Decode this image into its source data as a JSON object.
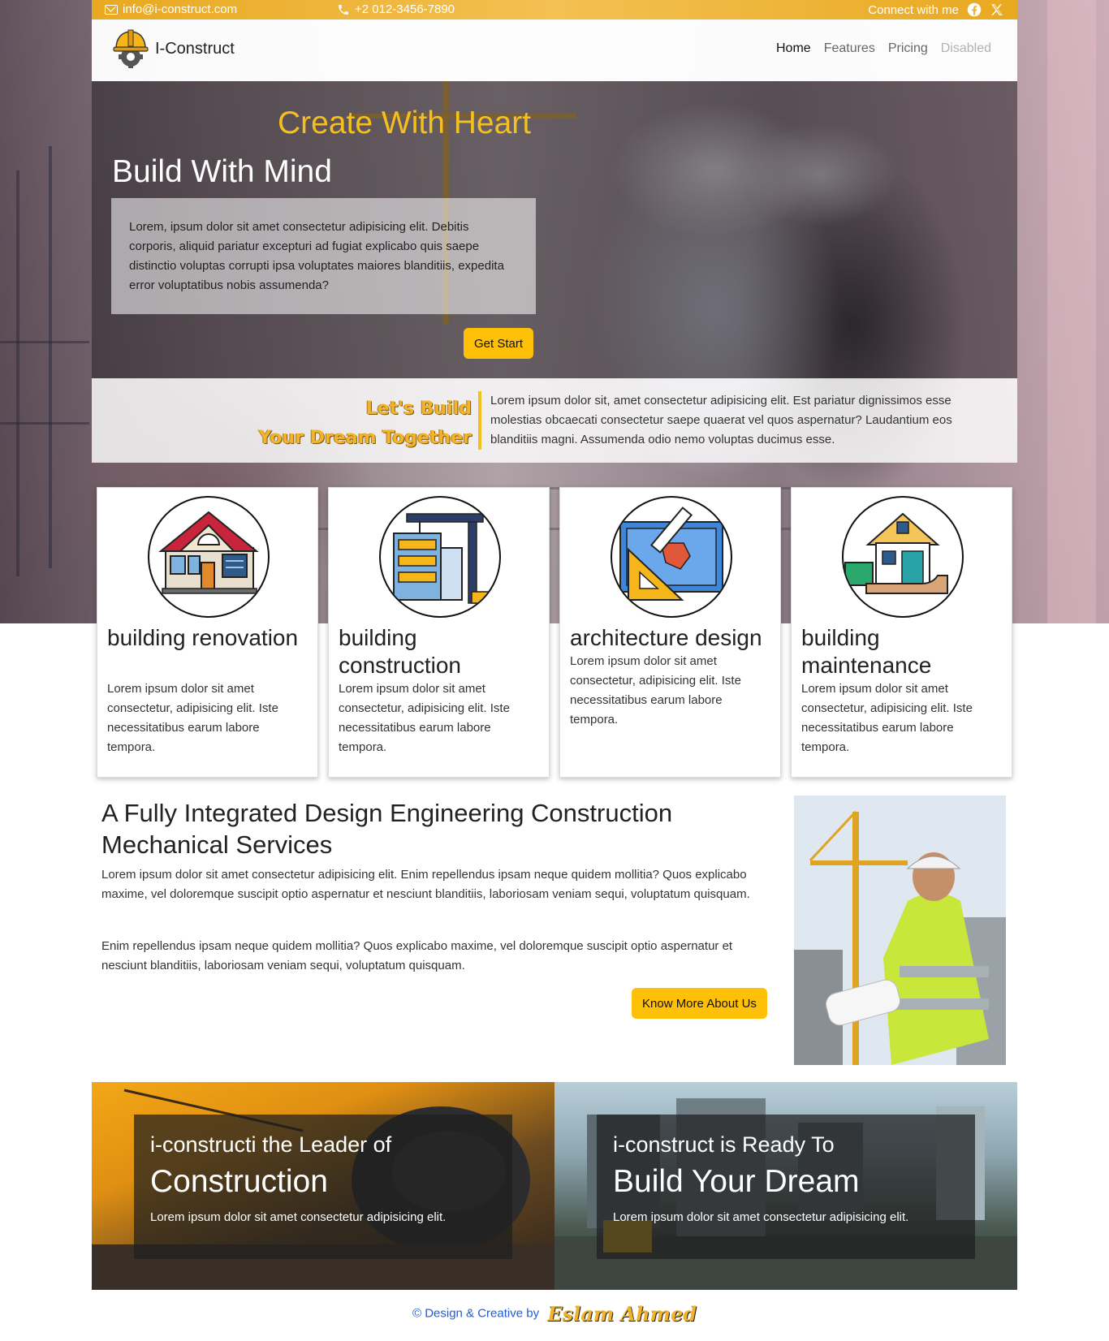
{
  "topbar": {
    "email": "info@i-construct.com",
    "phone": "+2 012-3456-7890",
    "connect": "Connect with me",
    "icons": [
      "mail-icon",
      "phone-icon",
      "facebook-icon",
      "x-icon"
    ]
  },
  "nav": {
    "brand": "I-Construct",
    "items": [
      {
        "label": "Home",
        "state": "active"
      },
      {
        "label": "Features",
        "state": "normal"
      },
      {
        "label": "Pricing",
        "state": "normal"
      },
      {
        "label": "Disabled",
        "state": "disabled"
      }
    ]
  },
  "hero": {
    "headline_accent": "Create With Heart",
    "headline": "Build With Mind",
    "text": "Lorem, ipsum dolor sit amet consectetur adipisicing elit. Debitis corporis, aliquid pariatur excepturi ad fugiat explicabo quis saepe distinctio voluptas corrupti ipsa voluptates maiores blanditiis, expedita error voluptatibus nobis assumenda?",
    "button": "Get Start"
  },
  "dream": {
    "title_line1": "Let's Build",
    "title_line2": "Your Dream Together",
    "text": "Lorem ipsum dolor sit, amet consectetur adipisicing elit. Est pariatur dignissimos esse molestias obcaecati consectetur saepe quaerat vel quos aspernatur? Laudantium eos blanditiis magni. Assumenda odio nemo voluptas ducimus esse."
  },
  "services": [
    {
      "title": "building renovation",
      "text": "Lorem ipsum dolor sit amet consectetur, adipisicing elit. Iste necessitatibus earum labore tempora.",
      "icon": "house-icon"
    },
    {
      "title": "building construction",
      "text": "Lorem ipsum dolor sit amet consectetur, adipisicing elit. Iste necessitatibus earum labore tempora.",
      "icon": "crane-building-icon"
    },
    {
      "title": "architecture design",
      "text": "Lorem ipsum dolor sit amet consectetur, adipisicing elit. Iste necessitatibus earum labore tempora.",
      "icon": "blueprint-icon"
    },
    {
      "title": "building maintenance",
      "text": "Lorem ipsum dolor sit amet consectetur, adipisicing elit. Iste necessitatibus earum labore tempora.",
      "icon": "house-hand-icon"
    }
  ],
  "about": {
    "title": "A Fully Integrated Design Engineering Construction Mechanical Services",
    "p1": "Lorem ipsum dolor sit amet consectetur adipisicing elit. Enim repellendus ipsam neque quidem mollitia? Quos explicabo maxime, vel doloremque suscipit optio aspernatur et nesciunt blanditiis, laboriosam veniam sequi, voluptatum quisquam.",
    "p2": "Enim repellendus ipsam neque quidem mollitia? Quos explicabo maxime, vel doloremque suscipit optio aspernatur et nesciunt blanditiis, laboriosam veniam sequi, voluptatum quisquam.",
    "button": "Know More About Us"
  },
  "banners": [
    {
      "line1": "i-constructi the Leader of",
      "line2": "Construction",
      "line3": "Lorem ipsum dolor sit amet consectetur adipisicing elit."
    },
    {
      "line1": "i-construct is Ready To",
      "line2": "Build Your Dream",
      "line3": "Lorem ipsum dolor sit amet consectetur adipisicing elit."
    }
  ],
  "footer": {
    "text": "© Design & Creative by",
    "signature": "Eslam Ahmed"
  },
  "colors": {
    "accent": "#fec107",
    "accent_text": "#f5bf1f",
    "footer_link": "#1f5bd7"
  }
}
